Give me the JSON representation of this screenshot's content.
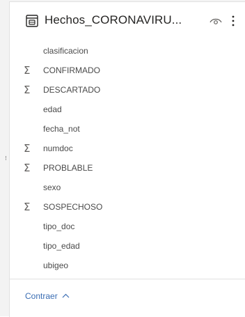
{
  "table": {
    "title": "Hechos_CORONAVIRU...",
    "icon": "table-icon"
  },
  "actions": {
    "visibility_icon": "eye-icon",
    "more_icon": "more-options-icon"
  },
  "fields": [
    {
      "label": "clasificacion",
      "aggregate": false
    },
    {
      "label": "CONFIRMADO",
      "aggregate": true
    },
    {
      "label": "DESCARTADO",
      "aggregate": true
    },
    {
      "label": "edad",
      "aggregate": false
    },
    {
      "label": "fecha_not",
      "aggregate": false
    },
    {
      "label": "numdoc",
      "aggregate": true
    },
    {
      "label": "PROBLABLE",
      "aggregate": true
    },
    {
      "label": "sexo",
      "aggregate": false
    },
    {
      "label": "SOSPECHOSO",
      "aggregate": true
    },
    {
      "label": "tipo_doc",
      "aggregate": false
    },
    {
      "label": "tipo_edad",
      "aggregate": false
    },
    {
      "label": "ubigeo",
      "aggregate": false
    }
  ],
  "sigma_symbol": "Σ",
  "footer": {
    "collapse_label": "Contraer"
  },
  "colors": {
    "accent": "#3a6db3",
    "text": "#4a4a4a",
    "title": "#252423"
  }
}
